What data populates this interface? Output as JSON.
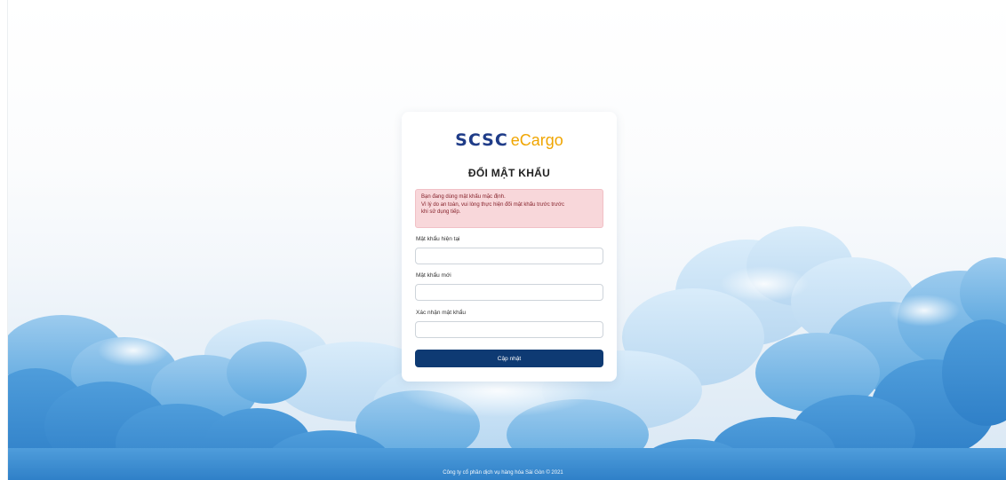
{
  "logo": {
    "brand": "SCSC",
    "product": "eCargo"
  },
  "form": {
    "title": "ĐỔI MẬT KHẨU",
    "alert_lines": [
      "Bạn đang dùng mật khẩu mặc định.",
      "Vì lý do an toàn, vui lòng thực hiện đổi mật khẩu trước trước",
      "khi sử dụng tiếp."
    ],
    "fields": [
      {
        "label": "Mật khẩu hiện tại",
        "value": "",
        "placeholder": ""
      },
      {
        "label": "Mật khẩu mới",
        "value": "",
        "placeholder": ""
      },
      {
        "label": "Xác nhận mật khẩu",
        "value": "",
        "placeholder": ""
      }
    ],
    "submit_label": "Cập nhật"
  },
  "footer": {
    "text": "Công ty cổ phần dịch vụ hàng hóa Sài Gòn © 2021"
  },
  "colors": {
    "brand_blue": "#1f3c88",
    "brand_orange": "#f0a500",
    "button": "#0e3a73",
    "alert_bg": "#f8d7da",
    "alert_text": "#842029",
    "sky": "#3a8fd6"
  }
}
